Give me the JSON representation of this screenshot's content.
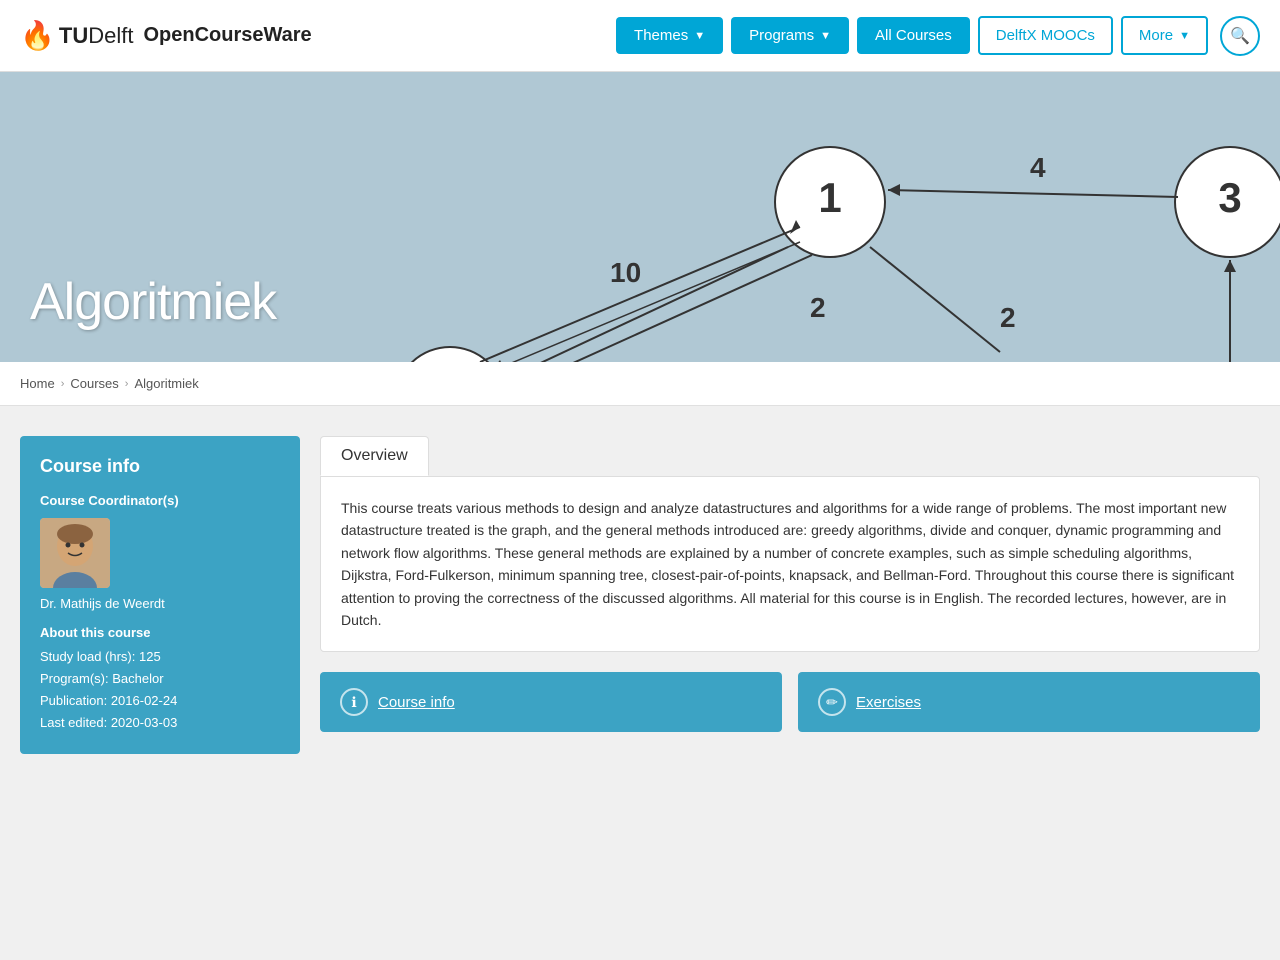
{
  "header": {
    "logo_tu": "TU",
    "logo_delft": "Delft",
    "logo_ocw": "OpenCourseWare",
    "nav": {
      "themes_label": "Themes",
      "programs_label": "Programs",
      "all_courses_label": "All Courses",
      "delftx_label": "DelftX MOOCs",
      "more_label": "More"
    }
  },
  "hero": {
    "title": "Algoritmiek"
  },
  "breadcrumb": {
    "home": "Home",
    "courses": "Courses",
    "current": "Algoritmiek"
  },
  "sidebar": {
    "title": "Course info",
    "coordinator_label": "Course Coordinator(s)",
    "instructor_name": "Dr. Mathijs de Weerdt",
    "about_title": "About this course",
    "study_load": "Study load (hrs): 125",
    "programs": "Program(s): Bachelor",
    "publication": "Publication: 2016-02-24",
    "last_edited": "Last edited: 2020-03-03"
  },
  "overview": {
    "tab_label": "Overview",
    "body_text": "This course treats various methods to design and analyze datastructures and algorithms for a wide range of problems. The most important new datastructure treated is the graph, and the general methods introduced are: greedy algorithms, divide and conquer, dynamic programming and network flow algorithms. These general methods are explained by a number of concrete examples, such as simple scheduling algorithms, Dijkstra, Ford-Fulkerson, minimum spanning tree, closest-pair-of-points, knapsack, and Bellman-Ford. Throughout this course there is significant attention to proving the correctness of the discussed algorithms. All material for this course is in English. The recorded lectures, however, are in Dutch."
  },
  "bottom_buttons": {
    "course_info_label": "Course info",
    "exercises_label": "Exercises"
  },
  "colors": {
    "primary": "#00A6D6",
    "sidebar_bg": "#3CA3C4",
    "hero_bg": "#b0c8d4"
  }
}
